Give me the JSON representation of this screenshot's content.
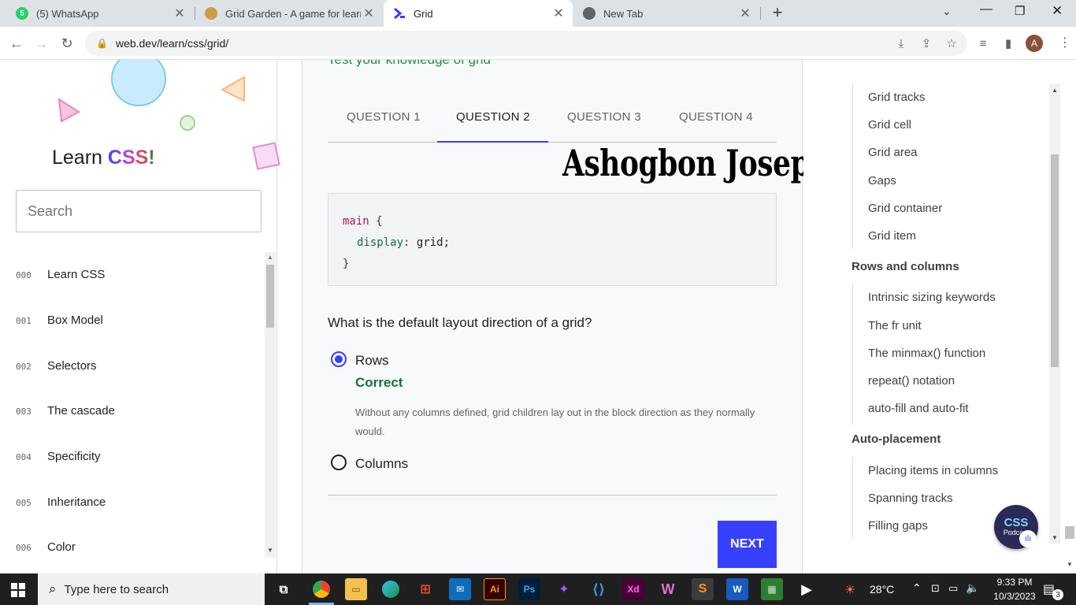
{
  "browser": {
    "tabs": [
      {
        "title": "(5) WhatsApp",
        "icon": "whatsapp-icon"
      },
      {
        "title": "Grid Garden - A game for learnir",
        "icon": "grid-garden-icon"
      },
      {
        "title": "Grid",
        "icon": "webdev-icon"
      },
      {
        "title": "New Tab",
        "icon": "chrome-icon"
      }
    ],
    "url": "web.dev/learn/css/grid/",
    "profile_initial": "A"
  },
  "left_nav": {
    "brand_learn": "Learn",
    "brand_css": "CSS!",
    "search_placeholder": "Search",
    "items": [
      {
        "num": "000",
        "label": "Learn CSS"
      },
      {
        "num": "001",
        "label": "Box Model"
      },
      {
        "num": "002",
        "label": "Selectors"
      },
      {
        "num": "003",
        "label": "The cascade"
      },
      {
        "num": "004",
        "label": "Specificity"
      },
      {
        "num": "005",
        "label": "Inheritance"
      },
      {
        "num": "006",
        "label": "Color"
      }
    ]
  },
  "main": {
    "heading_partial": "Test your knowledge of grid",
    "question_tabs": [
      "QUESTION 1",
      "QUESTION 2",
      "QUESTION 3",
      "QUESTION 4"
    ],
    "active_tab": 2,
    "watermark": "Ashogbon Joseph",
    "code": {
      "line1_selector": "main",
      "line1_brace": "{",
      "line2_property": "display",
      "line2_colon": ":",
      "line2_value": "grid;",
      "line3": "}"
    },
    "question": "What is the default layout direction of a grid?",
    "options": [
      {
        "label": "Rows",
        "selected": true
      },
      {
        "label": "Columns",
        "selected": false
      }
    ],
    "feedback_title": "Correct",
    "feedback_text": "Without any columns defined, grid children lay out in the block direction as they normally would.",
    "next_label": "NEXT"
  },
  "toc": {
    "items_top": [
      "Grid tracks",
      "Grid cell",
      "Grid area",
      "Gaps",
      "Grid container",
      "Grid item"
    ],
    "group1": "Rows and columns",
    "items_mid": [
      "Intrinsic sizing keywords",
      "The fr unit",
      "The minmax() function",
      "repeat() notation",
      "auto-fill and auto-fit"
    ],
    "group2": "Auto-placement",
    "items_bottom": [
      "Placing items in columns",
      "Spanning tracks",
      "Filling gaps"
    ],
    "podcast_badge_top": "CSS",
    "podcast_badge_bottom": "Podcast"
  },
  "taskbar": {
    "search_placeholder": "Type here to search",
    "weather": "28°C",
    "time": "9:33 PM",
    "date": "10/3/2023",
    "notification_count": "3"
  },
  "colors": {
    "accent": "#3740ff",
    "correct": "#137333",
    "code_keyword": "#b3135c",
    "code_property": "#1e6b3b"
  }
}
